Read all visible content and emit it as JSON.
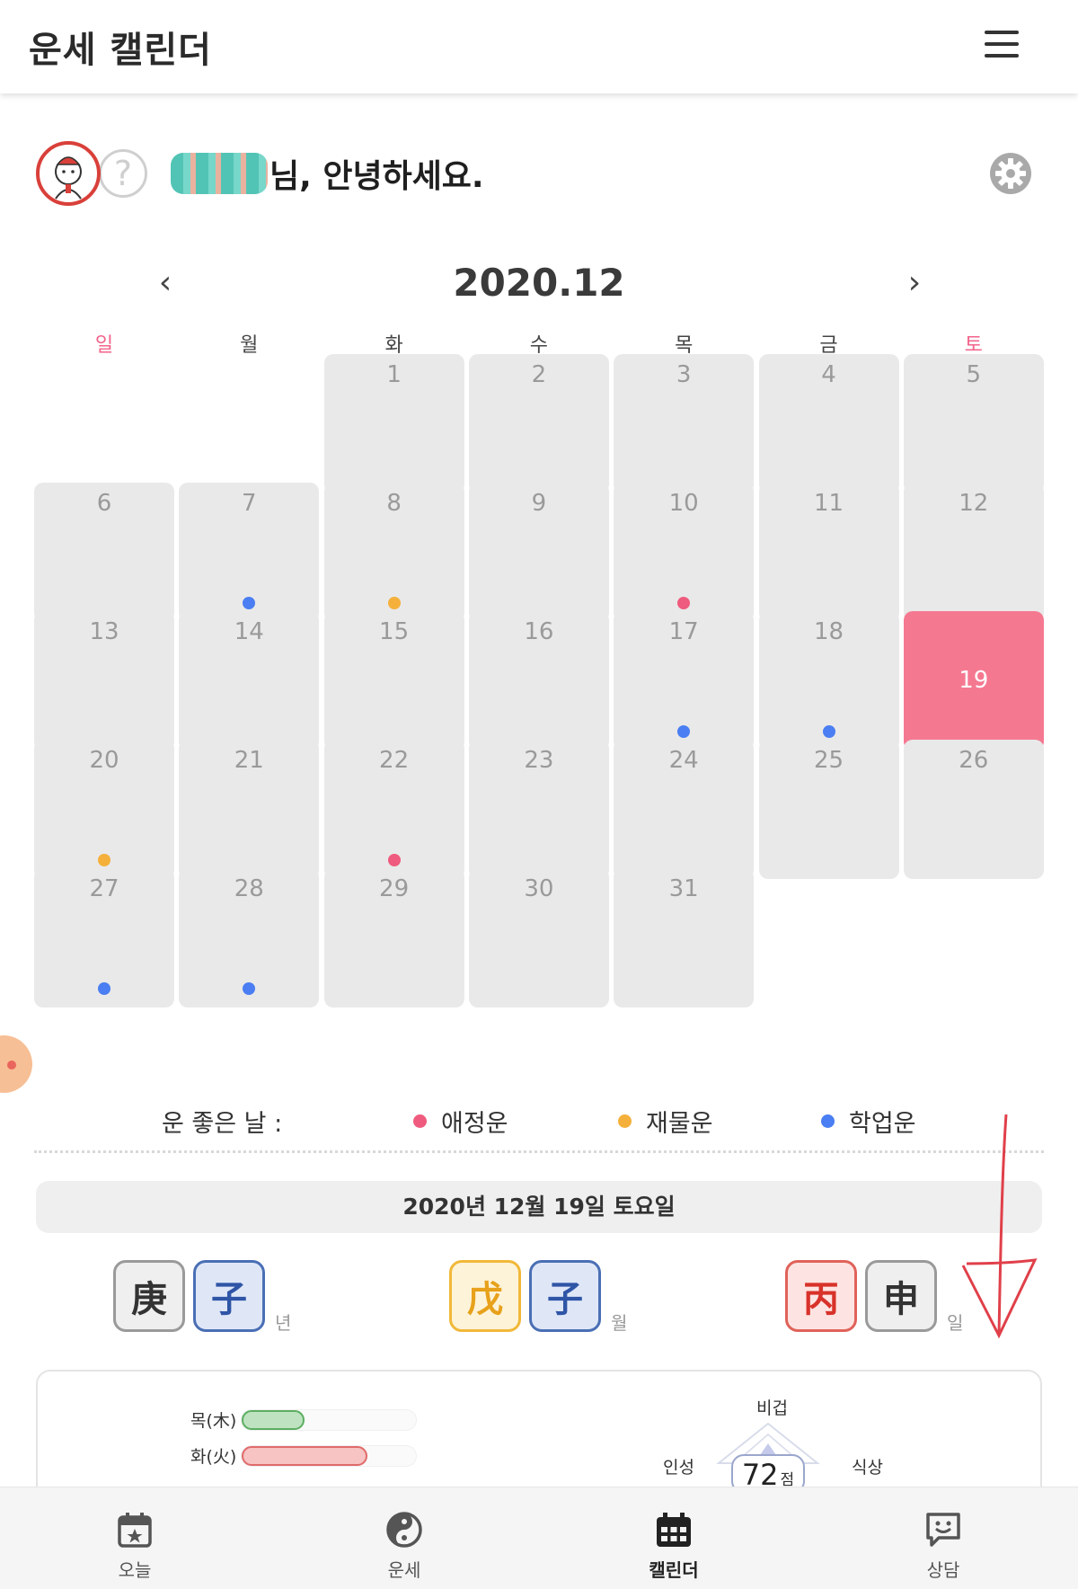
{
  "app": {
    "title": "운세 캘린더"
  },
  "greeting": {
    "text": "님, 안녕하세요."
  },
  "calendar": {
    "month_label": "2020.12",
    "prev": "‹",
    "next": "›",
    "weekdays": [
      "일",
      "월",
      "화",
      "수",
      "목",
      "금",
      "토"
    ],
    "first_weekday_index": 2,
    "days_in_month": 31,
    "selected_day": 19,
    "marks": [
      {
        "day": 7,
        "type": "study"
      },
      {
        "day": 8,
        "type": "wealth"
      },
      {
        "day": 10,
        "type": "love"
      },
      {
        "day": 17,
        "type": "study"
      },
      {
        "day": 18,
        "type": "study"
      },
      {
        "day": 20,
        "type": "wealth"
      },
      {
        "day": 22,
        "type": "love"
      },
      {
        "day": 27,
        "type": "study"
      },
      {
        "day": 28,
        "type": "study"
      }
    ]
  },
  "legend": {
    "label": "운 좋은 날 :",
    "items": [
      {
        "key": "love",
        "label": "애정운",
        "color": "#ef5b7e"
      },
      {
        "key": "wealth",
        "label": "재물운",
        "color": "#f5b03b"
      },
      {
        "key": "study",
        "label": "학업운",
        "color": "#4a7ef2"
      }
    ]
  },
  "selected_date_label": "2020년 12월 19일 토요일",
  "pillars": [
    {
      "chars": [
        "庚",
        "子"
      ],
      "styles": [
        "gray",
        "blue"
      ],
      "suffix": "년"
    },
    {
      "chars": [
        "戊",
        "子"
      ],
      "styles": [
        "yellow",
        "blue"
      ],
      "suffix": "월"
    },
    {
      "chars": [
        "丙",
        "申"
      ],
      "styles": [
        "red",
        "gray"
      ],
      "suffix": "일"
    }
  ],
  "elements": [
    {
      "label": "목(木)",
      "fraction": 0.36,
      "color": "#bfe3c0",
      "border": "#5cae61"
    },
    {
      "label": "화(火)",
      "fraction": 0.72,
      "color": "#f7c3c3",
      "border": "#e06a6a"
    }
  ],
  "radar": {
    "labels": [
      "비겁",
      "식상",
      "인성"
    ],
    "score": "72",
    "score_unit": "점"
  },
  "bottom_nav": [
    {
      "label": "오늘",
      "icon": "calendar-star-icon",
      "active": false
    },
    {
      "label": "운세",
      "icon": "yin-yang-icon",
      "active": false
    },
    {
      "label": "캘린더",
      "icon": "calendar-icon",
      "active": true
    },
    {
      "label": "상담",
      "icon": "chat-smile-icon",
      "active": false
    }
  ]
}
